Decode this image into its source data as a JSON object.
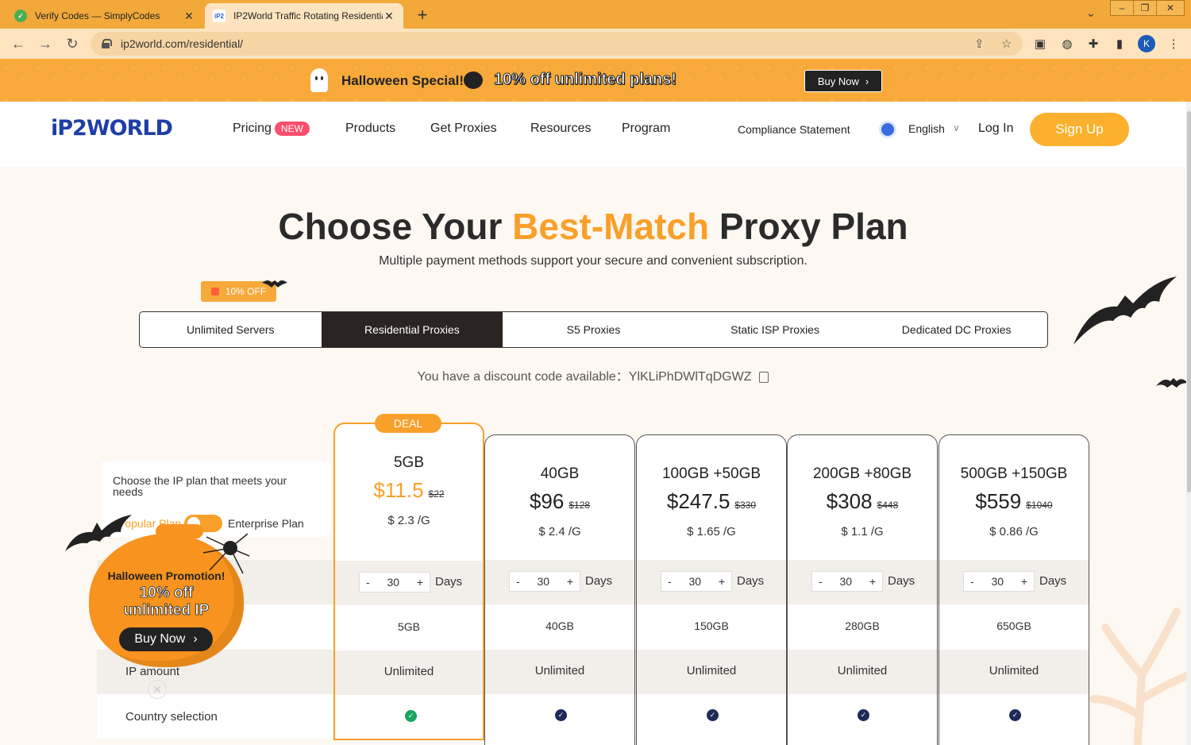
{
  "browser": {
    "tabs": [
      {
        "title": "Verify Codes — SimplyCodes",
        "active": false
      },
      {
        "title": "IP2World Traffic Rotating Residentia",
        "active": true
      }
    ],
    "url": "ip2world.com/residential/",
    "profile_initial": "K"
  },
  "promo_banner": {
    "special": "Halloween Special!",
    "offer": "10% off unlimited plans!",
    "buy_label": "Buy Now"
  },
  "header": {
    "logo": "iP2WORLD",
    "nav": [
      "Pricing",
      "Products",
      "Get Proxies",
      "Resources",
      "Program"
    ],
    "new_badge": "NEW",
    "compliance": "Compliance Statement",
    "language": "English",
    "login": "Log In",
    "signup": "Sign Up"
  },
  "hero": {
    "title_pre": "Choose Your ",
    "title_accent": "Best-Match",
    "title_post": " Proxy Plan",
    "subtitle": "Multiple payment methods support your secure and convenient subscription."
  },
  "product_tabs": {
    "off_tag": "10% OFF",
    "items": [
      "Unlimited Servers",
      "Residential Proxies",
      "S5 Proxies",
      "Static ISP Proxies",
      "Dedicated DC Proxies"
    ],
    "active_index": 1
  },
  "discount": {
    "text": "You have a discount code available：YlKLiPhDWlTqDGWZ"
  },
  "feature_panel": {
    "prompt": "Choose the IP plan that meets your needs",
    "popular": "Popular Plan",
    "enterprise": "Enterprise Plan",
    "rows": [
      "IP amount",
      "Country selection"
    ]
  },
  "deal_label": "DEAL",
  "plans": [
    {
      "size": "5GB",
      "price": "$11.5",
      "old": "$22",
      "per_g": "$ 2.3 /G",
      "days": "30",
      "days_label": "Days",
      "traffic": "5GB",
      "ips": "Unlimited",
      "deal": true
    },
    {
      "size": "40GB",
      "price": "$96",
      "old": "$128",
      "per_g": "$ 2.4 /G",
      "days": "30",
      "days_label": "Days",
      "traffic": "40GB",
      "ips": "Unlimited",
      "deal": false
    },
    {
      "size": "100GB +50GB",
      "price": "$247.5",
      "old": "$330",
      "per_g": "$ 1.65 /G",
      "days": "30",
      "days_label": "Days",
      "traffic": "150GB",
      "ips": "Unlimited",
      "deal": false
    },
    {
      "size": "200GB +80GB",
      "price": "$308",
      "old": "$448",
      "per_g": "$ 1.1 /G",
      "days": "30",
      "days_label": "Days",
      "traffic": "280GB",
      "ips": "Unlimited",
      "deal": false
    },
    {
      "size": "500GB +150GB",
      "price": "$559",
      "old": "$1040",
      "per_g": "$ 0.86 /G",
      "days": "30",
      "days_label": "Days",
      "traffic": "650GB",
      "ips": "Unlimited",
      "deal": false
    }
  ],
  "stepper": {
    "minus": "-",
    "plus": "+"
  },
  "halloween_widget": {
    "title": "Halloween Promotion!",
    "line1": "10% off",
    "line2": "unlimited IP",
    "buy_label": "Buy Now"
  },
  "colors": {
    "accent": "#f9a02a",
    "dark": "#2a2422",
    "brand": "#2b6ff0",
    "badge": "#ff4d6d"
  }
}
